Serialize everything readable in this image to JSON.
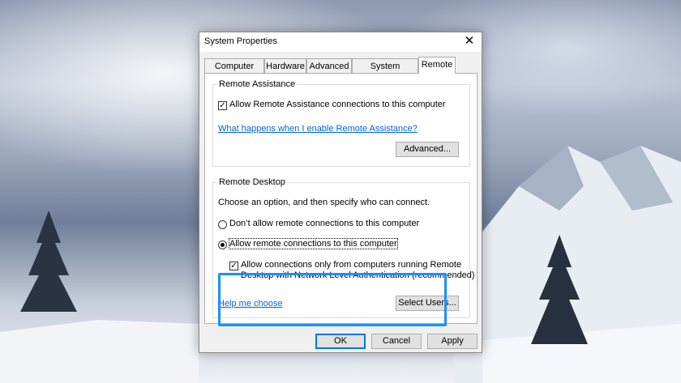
{
  "window": {
    "title": "System Properties",
    "close_glyph": "✕"
  },
  "tabs": [
    {
      "label": "Computer Name",
      "active": false
    },
    {
      "label": "Hardware",
      "active": false
    },
    {
      "label": "Advanced",
      "active": false
    },
    {
      "label": "System Protection",
      "active": false
    },
    {
      "label": "Remote",
      "active": true
    }
  ],
  "remote_assistance": {
    "group_title": "Remote Assistance",
    "allow_label": "Allow Remote Assistance connections to this computer",
    "allow_checked": true,
    "help_link": "What happens when I enable Remote Assistance?",
    "advanced_button": "Advanced..."
  },
  "remote_desktop": {
    "group_title": "Remote Desktop",
    "intro": "Choose an option, and then specify who can connect.",
    "option_dont_allow": "Don’t allow remote connections to this computer",
    "option_allow": "Allow remote connections to this computer",
    "selected_option": "allow",
    "nla_label_line1": "Allow connections only from computers running Remote",
    "nla_label_line2": "Desktop with Network Level Authentication (recommended)",
    "nla_checked": true,
    "help_link": "Help me choose",
    "select_users_button": "Select Users..."
  },
  "footer": {
    "ok": "OK",
    "cancel": "Cancel",
    "apply": "Apply"
  },
  "colors": {
    "highlight": "#1a90ff",
    "link": "#0066cc",
    "default_button_border": "#0078d7"
  }
}
